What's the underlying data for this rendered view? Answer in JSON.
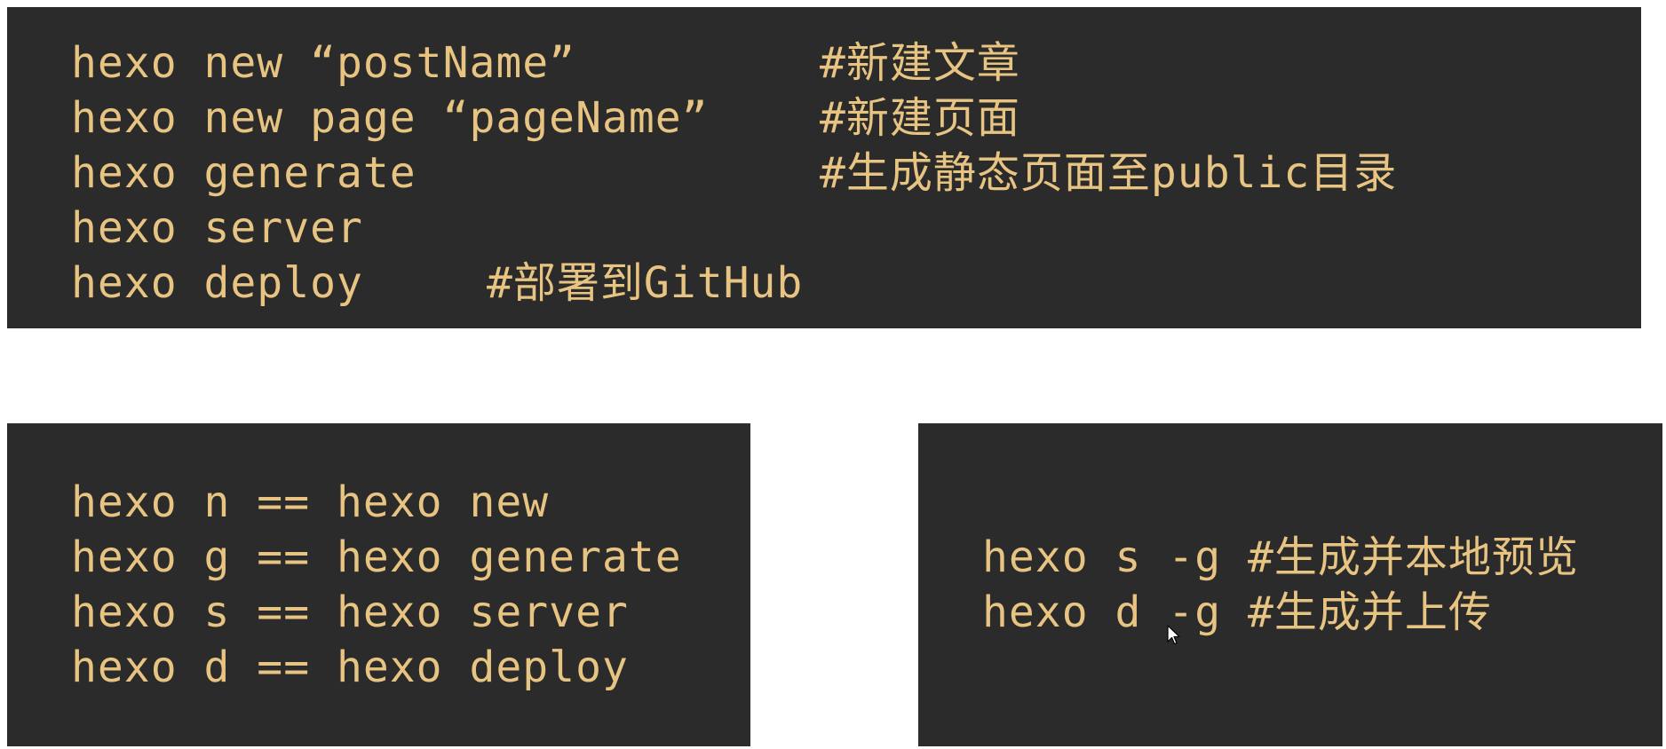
{
  "top_panel": {
    "lines": [
      {
        "command": "hexo new “postName”",
        "comment": "#新建文章"
      },
      {
        "command": "hexo new page “pageName”",
        "comment": "#新建页面"
      },
      {
        "command": "hexo generate",
        "comment": "#生成静态页面至public目录"
      },
      {
        "command": "hexo server",
        "comment": ""
      },
      {
        "command": "hexo deploy",
        "comment": "#部署到GitHub"
      }
    ]
  },
  "left_panel": {
    "lines": [
      "hexo n == hexo new",
      "hexo g == hexo generate",
      "hexo s == hexo server",
      "hexo d == hexo deploy"
    ]
  },
  "right_panel": {
    "lines": [
      "hexo s -g #生成并本地预览",
      "hexo d -g #生成并上传"
    ]
  },
  "colors": {
    "panel_background": "#2b2b2b",
    "text": "#e8c482",
    "page_background": "#ffffff"
  },
  "icons": {
    "cursor": "mouse-pointer-icon"
  }
}
